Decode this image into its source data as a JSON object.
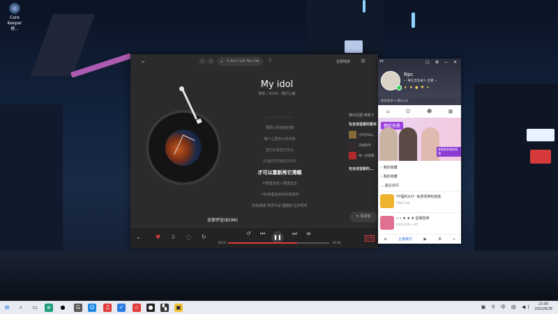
{
  "desktop": {
    "icon_label": "Core Keeper 地..."
  },
  "player": {
    "search_text": "It Ain't Got You (Ve",
    "right_label": "全屏纯享",
    "song": {
      "title": "My idol",
      "meta": "简单 / XXX0 - 我们小破"
    },
    "lyrics": [
      {
        "text": "........................",
        "current": false
      },
      {
        "text": "把辰心情送给时箱",
        "current": false
      },
      {
        "text": "每个心里有心的花味",
        "current": false
      },
      {
        "text": "自己打有自己可以",
        "current": false
      },
      {
        "text": "[1]自己打有自己可以",
        "current": false
      },
      {
        "text": "才可以重新再它滑踢",
        "current": true
      },
      {
        "text": "不要害怕有人要害史去",
        "current": false
      },
      {
        "text": "下秒的瓶体何的的情感归",
        "current": false
      },
      {
        "text": "你是偶偶 现再不就 翻翻我 应声再听",
        "current": false
      }
    ],
    "reco": {
      "header": "佛出花圈 奥斯卡",
      "title1": "包含该首歌的歌单",
      "items": [
        "[华语]Nig...",
        "流线歌单",
        "每一首歌都..."
      ],
      "title2": "包含该首歌的..."
    },
    "comments": "全部评论(8196)",
    "write_comment": "写评论",
    "time_elapsed": "00:23",
    "time_total": "03:44",
    "progress": 0.68,
    "badge": "标准"
  },
  "qq": {
    "app_label": "YY",
    "nickname": "Npc",
    "signature": "~ 事在出生被人 歪着 ~",
    "badges": "★ ♦ ● ♥ ✦",
    "search_placeholder": "搜索联系人/群/公号",
    "banner_tag": "精彩世界",
    "banner_cta": "查看更多精彩视频",
    "groups": [
      "我的收藏",
      "我的收藏",
      "最近访问"
    ],
    "items": [
      {
        "title": "YY福利大厅 ·免费领神权皮肤",
        "sub": "3642.2w",
        "color": "#f0b330"
      },
      {
        "title": "» » ♦ ♦ ♦ 星耀皇帝",
        "sub": "0202139  • 45",
        "color": "#e06f90"
      }
    ],
    "bottom_label": "企鹅精灵"
  },
  "taskbar": {
    "time": "23:00",
    "date": "2022/6/28",
    "tray_text": "中"
  }
}
